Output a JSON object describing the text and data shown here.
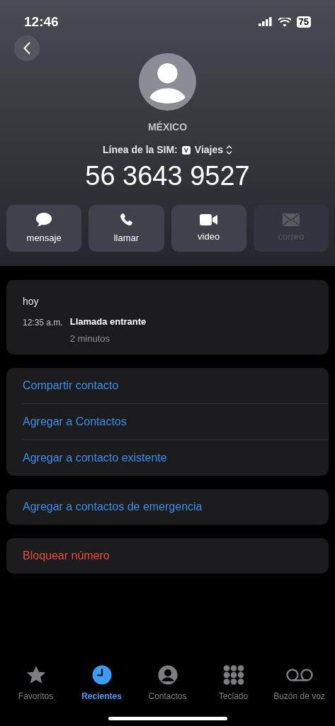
{
  "status_bar": {
    "time": "12:46",
    "battery": "75"
  },
  "contact": {
    "label": "MÉXICO",
    "sim_label": "Línea de la SIM:",
    "sim_badge": "V",
    "sim_name": "Viajes",
    "number": "56 3643 9527"
  },
  "actions": [
    {
      "kind": "message",
      "label": "mensaje",
      "disabled": false
    },
    {
      "kind": "call",
      "label": "llamar",
      "disabled": false
    },
    {
      "kind": "video",
      "label": "video",
      "disabled": false
    },
    {
      "kind": "mail",
      "label": "correo",
      "disabled": true
    }
  ],
  "call_log": {
    "day": "hoy",
    "entries": [
      {
        "time": "12:35 a.m.",
        "type": "Llamada entrante",
        "duration": "2 minutos"
      }
    ]
  },
  "option_groups": [
    [
      {
        "label": "Compartir contacto",
        "kind": "link"
      },
      {
        "label": "Agregar a Contactos",
        "kind": "link"
      },
      {
        "label": "Agregar a contacto existente",
        "kind": "link"
      }
    ],
    [
      {
        "label": "Agregar a contactos de emergencia",
        "kind": "link"
      }
    ],
    [
      {
        "label": "Bloquear número",
        "kind": "destructive"
      }
    ]
  ],
  "tab_bar": [
    {
      "kind": "favorites",
      "label": "Favoritos",
      "selected": false
    },
    {
      "kind": "recents",
      "label": "Recientes",
      "selected": true
    },
    {
      "kind": "contacts",
      "label": "Contactos",
      "selected": false
    },
    {
      "kind": "keypad",
      "label": "Teclado",
      "selected": false
    },
    {
      "kind": "voicemail",
      "label": "Buzón de voz",
      "selected": false
    }
  ]
}
